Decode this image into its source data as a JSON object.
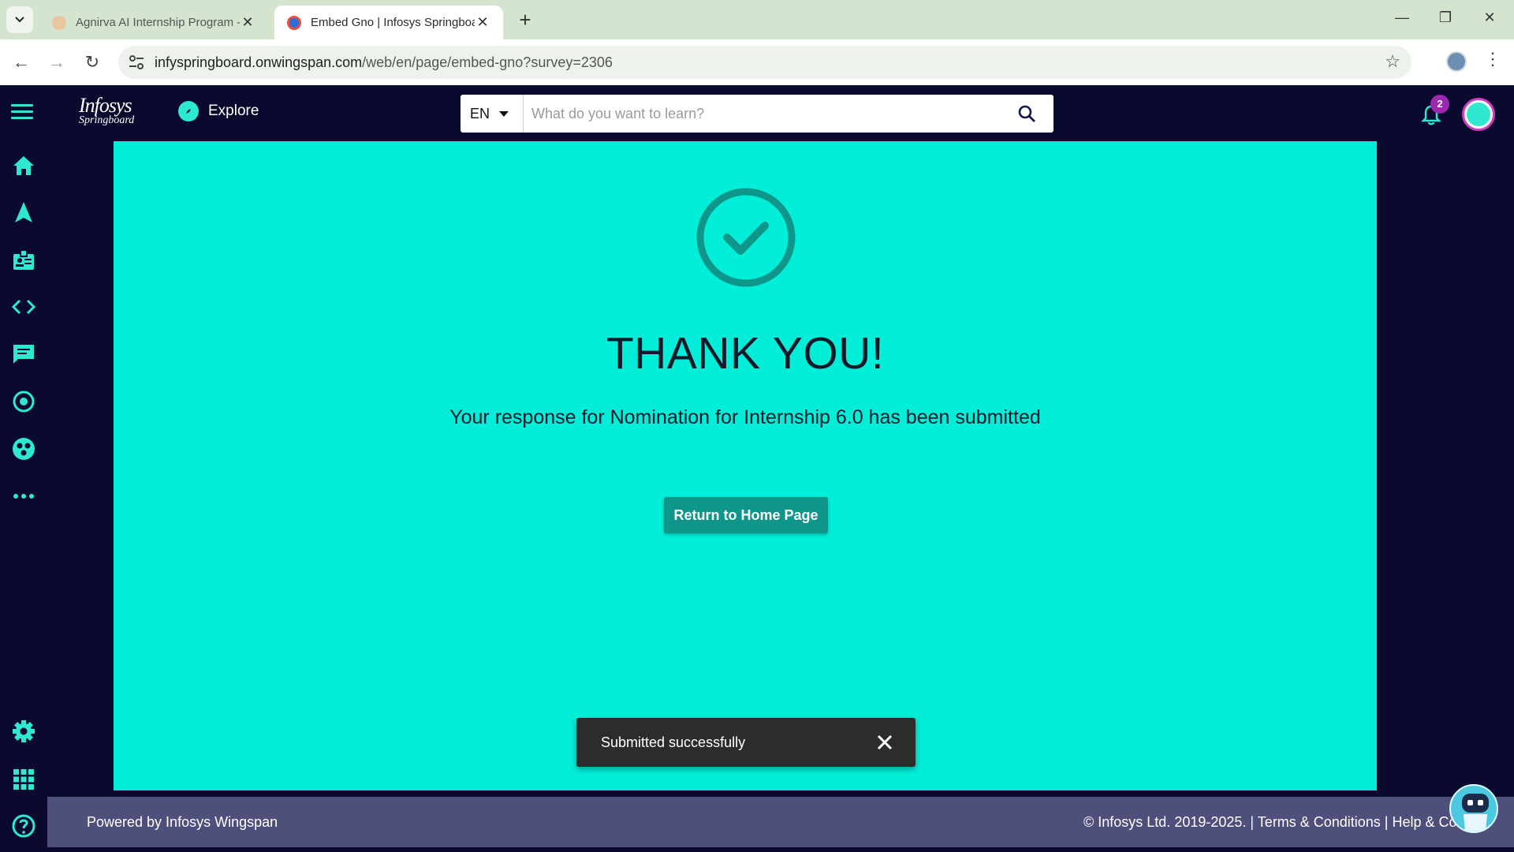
{
  "browser": {
    "tabs": [
      {
        "title": "Agnirva AI Internship Program -",
        "active": false
      },
      {
        "title": "Embed Gno | Infosys Springboa",
        "active": true
      }
    ],
    "url_host": "infyspringboard.onwingspan.com",
    "url_path": "/web/en/page/embed-gno?survey=2306"
  },
  "header": {
    "logo_line1": "Infosys",
    "logo_line2": "Springboard",
    "explore_label": "Explore",
    "lang": "EN",
    "search_placeholder": "What do you want to learn?",
    "notification_count": "2"
  },
  "sidebar": {
    "icons": [
      "home-icon",
      "navigation-icon",
      "badge-icon",
      "code-icon",
      "chat-icon",
      "target-icon",
      "community-icon",
      "more-icon",
      "settings-icon",
      "apps-grid-icon",
      "help-icon"
    ]
  },
  "main": {
    "heading": "THANK YOU!",
    "message": "Your response for Nomination for Internship 6.0 has been submitted",
    "button_label": "Return to Home Page"
  },
  "toast": {
    "text": "Submitted successfully"
  },
  "footer": {
    "left": "Powered by Infosys Wingspan",
    "right": "© Infosys Ltd. 2019-2025. | Terms & Conditions | Help & Contact"
  },
  "colors": {
    "accent": "#2fe8d0",
    "main_bg": "#03eed8",
    "button": "#0e968a",
    "nav_bg": "#0a0a2e",
    "footer_bg": "#4e4f7a",
    "badge": "#9c27b0"
  }
}
